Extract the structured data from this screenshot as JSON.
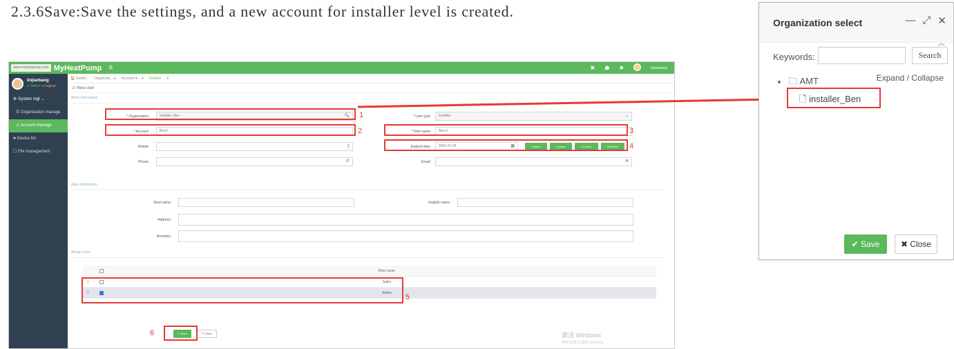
{
  "caption": "2.3.6Save:Save the settings, and a new account for installer level is created.",
  "app": {
    "url_badge": "www.myheatpump.com",
    "brand": "MyHeatPump",
    "menu_glyph": "≡",
    "top_icons": {
      "close": "✖",
      "home": "☗",
      "settings": "✹"
    },
    "top_user": "linjianbang"
  },
  "sidebar": {
    "user": "linjianbang",
    "status_online": "● Online",
    "status_logout": "⇥ Logout",
    "items": [
      {
        "label": "⚙ System mgt  ⌄"
      },
      {
        "label": "☰ Organization manage"
      },
      {
        "label": "♙ Account manage"
      },
      {
        "label": "♣ Device list"
      },
      {
        "label": "☐ File management"
      }
    ]
  },
  "tabs": [
    "🏠 Dashb...",
    "Organizati... ●",
    "Account m... ●",
    "Installer",
    "●"
  ],
  "page_title": "♙ New user",
  "sections": {
    "basic": "Basic information",
    "more": "More information",
    "roles": "Assign roles"
  },
  "form": {
    "organization": {
      "label": "* Organization:",
      "value": "installer_Ben",
      "icon": "🔍"
    },
    "account": {
      "label": "* Account:",
      "value": "Ben2"
    },
    "mobile": {
      "label": "Mobile:",
      "value": "",
      "icon": "▯"
    },
    "phone": {
      "label": "Phone:",
      "value": "",
      "icon": "✆"
    },
    "user_type": {
      "label": "* User type:",
      "value": "Installer",
      "icon": "⌄"
    },
    "nick_name": {
      "label": "* Nick name:",
      "value": "Ben-2"
    },
    "expired_date": {
      "label": "Expired date:",
      "value": "2052-07-06",
      "icon": "▦"
    },
    "email": {
      "label": "Email:",
      "value": "",
      "icon": "✉"
    },
    "year_buttons": [
      "5 years",
      "6 years",
      "10 years",
      "Unlimited"
    ],
    "real_name": {
      "label": "Real name:"
    },
    "english_name": {
      "label": "English name:"
    },
    "address": {
      "label": "Address:"
    },
    "remarks": {
      "label": "Remarks:"
    }
  },
  "roles_table": {
    "header": "Role name",
    "rows": [
      {
        "num": "1",
        "name": "Sales",
        "checked": false
      },
      {
        "num": "2",
        "name": "Admin",
        "checked": true
      }
    ]
  },
  "footer": {
    "save": "✔ Save",
    "close": "↰ Close"
  },
  "watermark": {
    "line1": "激活 Windows",
    "line2": "转到\"设置\"以激活 Windows。"
  },
  "markers": [
    "1",
    "2",
    "3",
    "4",
    "5",
    "6"
  ],
  "dialog": {
    "title": "Organization select",
    "controls": {
      "minimize": "—",
      "maximize": "⤢",
      "close": "✕"
    },
    "collapse_glyph": "︽",
    "keywords_label": "Keywords:",
    "search": "Search",
    "tree_caret": "▼",
    "tree_folder": "🗀",
    "tree_root": "AMT",
    "expand_collapse": "Expand / Collapse",
    "file_glyph": "🗋",
    "tree_leaf": "installer_Ben",
    "save": "✔ Save",
    "close": "✖ Close"
  },
  "colors": {
    "accent": "#5cb85c",
    "sidebar": "#2f4050",
    "annotation": "#e53935"
  }
}
